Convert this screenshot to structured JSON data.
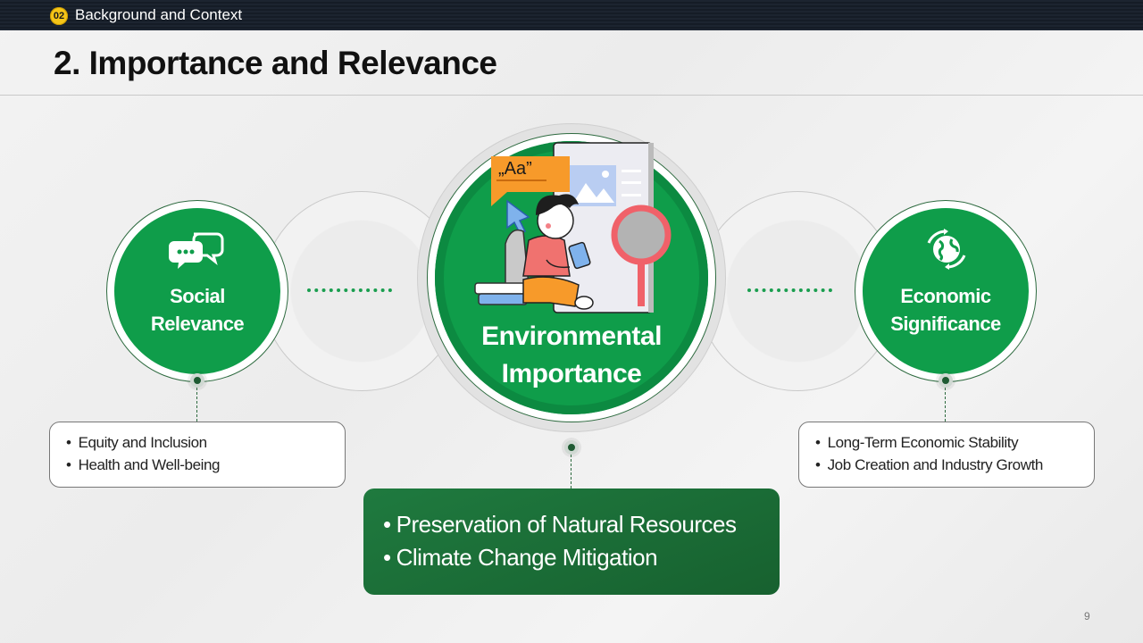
{
  "header": {
    "section_number": "02",
    "section_title": "Background and Context"
  },
  "page_title": "2. Importance and Relevance",
  "social": {
    "label_line1": "Social",
    "label_line2": "Relevance",
    "icon": "chat-bubbles-icon",
    "bullets": [
      "Equity and Inclusion",
      "Health and Well-being"
    ]
  },
  "environmental": {
    "label_line1": "Environmental",
    "label_line2": "Importance",
    "illustration": "person-reading-tablet-illustration",
    "illustration_text": "„Aa”",
    "bullets": [
      "Preservation of Natural Resources",
      "Climate Change Mitigation"
    ]
  },
  "economic": {
    "label_line1": "Economic",
    "label_line2": "Significance",
    "icon": "globe-recycle-icon",
    "bullets": [
      "Long-Term Economic Stability",
      "Job Creation and Industry Growth"
    ]
  },
  "page_number": "9",
  "colors": {
    "primary_green": "#0f9d4a",
    "dark_green": "#17612f",
    "accent_yellow": "#f5c518",
    "header_bar": "#1c2430"
  }
}
